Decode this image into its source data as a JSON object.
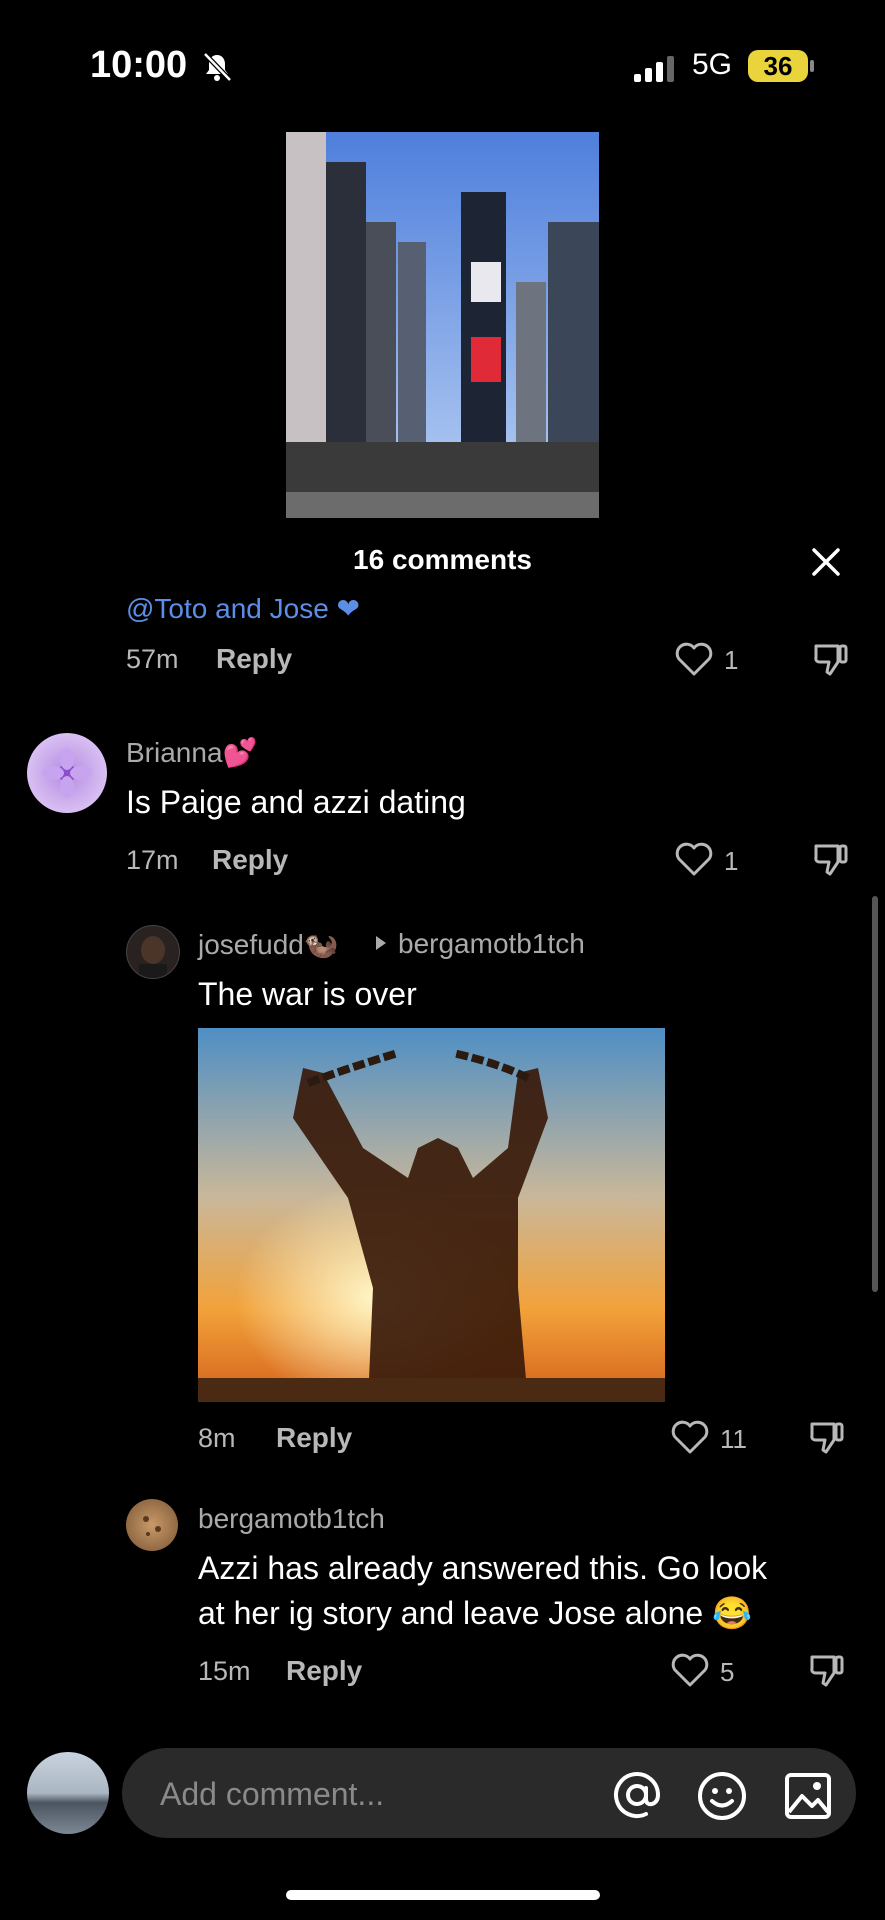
{
  "status_bar": {
    "time": "10:00",
    "network": "5G",
    "battery": "36"
  },
  "video": {
    "description_icon": "video-thumbnail"
  },
  "header": {
    "title": "16 comments"
  },
  "comments": [
    {
      "clipped_text": "@Toto and Jose ❤",
      "time": "57m",
      "reply_label": "Reply",
      "likes": "1"
    },
    {
      "username": "Brianna💕",
      "text": "Is Paige and azzi dating",
      "time": "17m",
      "reply_label": "Reply",
      "likes": "1"
    },
    {
      "username": "josefudd🦦",
      "reply_to": "bergamotb1tch",
      "text": "The war is over",
      "time": "8m",
      "reply_label": "Reply",
      "likes": "11"
    },
    {
      "username": "bergamotb1tch",
      "text_line1": "Azzi has already answered this. Go look",
      "text_line2": "at her ig story and leave Jose alone 😂",
      "time": "15m",
      "reply_label": "Reply",
      "likes": "5"
    }
  ],
  "composer": {
    "placeholder": "Add comment..."
  },
  "colors": {
    "background": "#000000",
    "mention": "#5b8ee6",
    "battery": "#e9d43b"
  }
}
